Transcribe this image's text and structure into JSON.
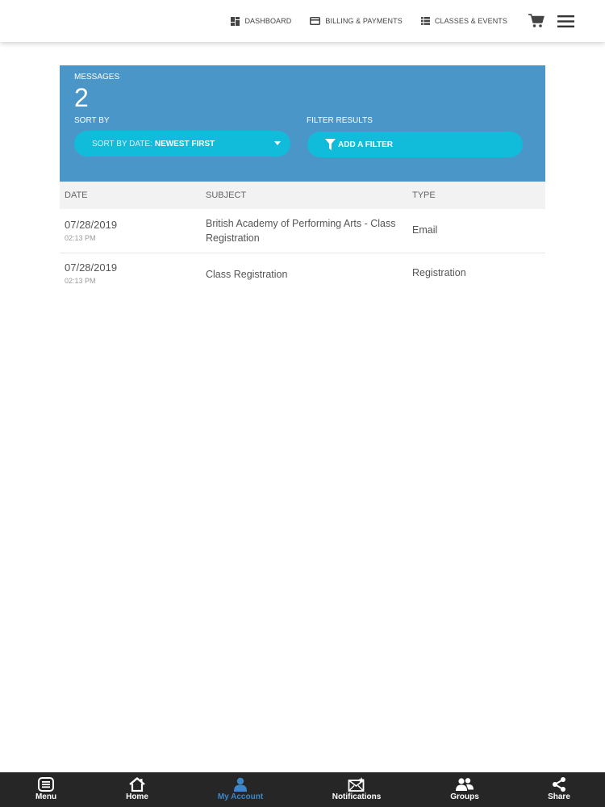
{
  "topnav": {
    "links": [
      {
        "label": "DASHBOARD",
        "icon": "dashboard-icon"
      },
      {
        "label": "BILLING & PAYMENTS",
        "icon": "credit-card-icon"
      },
      {
        "label": "CLASSES & EVENTS",
        "icon": "list-icon"
      }
    ],
    "cart_icon": "cart-icon",
    "menu_icon": "hamburger-icon"
  },
  "panel": {
    "title": "MESSAGES",
    "count": "2",
    "sort_label": "SORT BY",
    "sort_prefix": "SORT BY DATE:",
    "sort_value": "NEWEST FIRST",
    "filter_label": "FILTER RESULTS",
    "filter_button": "ADD A FILTER",
    "background_color": "#4b96c8",
    "pill_color": "#10bcd9"
  },
  "table": {
    "headers": [
      "DATE",
      "SUBJECT",
      "TYPE"
    ],
    "rows": [
      {
        "date": "07/28/2019",
        "time": "02:13 PM",
        "subject": "British Academy of Performing Arts - Class Registration",
        "type": "Email"
      },
      {
        "date": "07/28/2019",
        "time": "02:13 PM",
        "subject": "Class Registration",
        "type": "Registration"
      }
    ]
  },
  "tabbar": {
    "tabs": [
      {
        "label": "Menu",
        "icon": "menu-icon",
        "active": false
      },
      {
        "label": "Home",
        "icon": "home-icon",
        "active": false
      },
      {
        "label": "My Account",
        "icon": "account-icon",
        "active": true
      },
      {
        "label": "Notifications",
        "icon": "envelope-icon",
        "active": false
      },
      {
        "label": "Groups",
        "icon": "groups-icon",
        "active": false
      },
      {
        "label": "Share",
        "icon": "share-icon",
        "active": false
      }
    ],
    "active_color": "#3d86c6"
  }
}
